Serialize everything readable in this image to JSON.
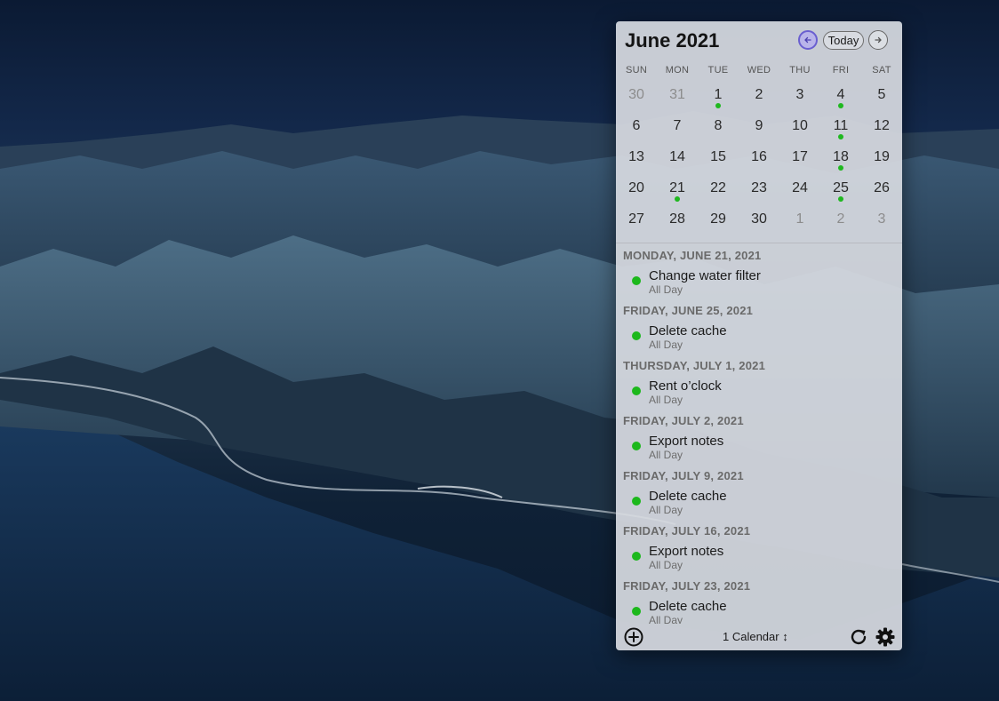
{
  "header": {
    "month_title": "June 2021",
    "today_label": "Today"
  },
  "weekdays": [
    "SUN",
    "MON",
    "TUE",
    "WED",
    "THU",
    "FRI",
    "SAT"
  ],
  "weeks": [
    [
      {
        "d": "30",
        "other": true
      },
      {
        "d": "31",
        "other": true
      },
      {
        "d": "1",
        "dot": true
      },
      {
        "d": "2"
      },
      {
        "d": "3"
      },
      {
        "d": "4",
        "dot": true
      },
      {
        "d": "5"
      }
    ],
    [
      {
        "d": "6"
      },
      {
        "d": "7"
      },
      {
        "d": "8"
      },
      {
        "d": "9"
      },
      {
        "d": "10"
      },
      {
        "d": "11",
        "dot": true
      },
      {
        "d": "12"
      }
    ],
    [
      {
        "d": "13"
      },
      {
        "d": "14"
      },
      {
        "d": "15"
      },
      {
        "d": "16"
      },
      {
        "d": "17"
      },
      {
        "d": "18",
        "dot": true
      },
      {
        "d": "19"
      }
    ],
    [
      {
        "d": "20"
      },
      {
        "d": "21",
        "dot": true
      },
      {
        "d": "22"
      },
      {
        "d": "23"
      },
      {
        "d": "24"
      },
      {
        "d": "25",
        "dot": true
      },
      {
        "d": "26"
      }
    ],
    [
      {
        "d": "27"
      },
      {
        "d": "28"
      },
      {
        "d": "29"
      },
      {
        "d": "30"
      },
      {
        "d": "1",
        "other": true
      },
      {
        "d": "2",
        "other": true
      },
      {
        "d": "3",
        "other": true
      }
    ]
  ],
  "events": [
    {
      "date": "MONDAY, JUNE 21, 2021",
      "title": "Change water filter",
      "sub": "All Day"
    },
    {
      "date": "FRIDAY, JUNE 25, 2021",
      "title": "Delete cache",
      "sub": "All Day"
    },
    {
      "date": "THURSDAY, JULY 1, 2021",
      "title": "Rent o’clock",
      "sub": "All Day"
    },
    {
      "date": "FRIDAY, JULY 2, 2021",
      "title": "Export notes",
      "sub": "All Day"
    },
    {
      "date": "FRIDAY, JULY 9, 2021",
      "title": "Delete cache",
      "sub": "All Day"
    },
    {
      "date": "FRIDAY, JULY 16, 2021",
      "title": "Export notes",
      "sub": "All Day"
    },
    {
      "date": "FRIDAY, JULY 23, 2021",
      "title": "Delete cache",
      "sub": "All Day"
    }
  ],
  "footer": {
    "calendar_select_label": "1 Calendar ↕"
  },
  "colors": {
    "event_dot": "#1cb81c",
    "nav_accent": "#6a5fd0"
  }
}
